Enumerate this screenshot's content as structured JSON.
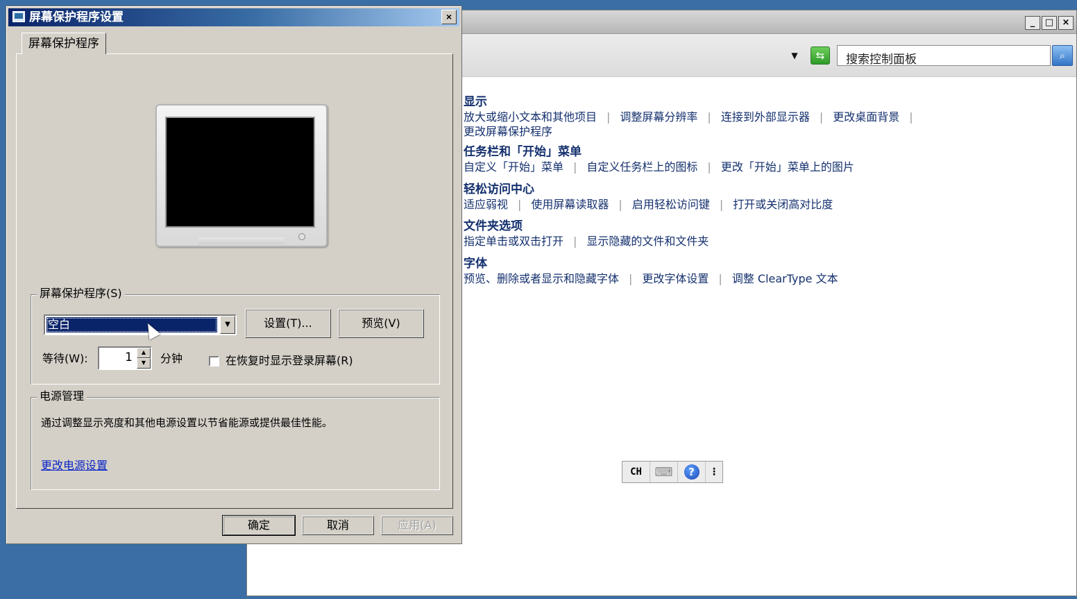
{
  "control_panel": {
    "window_buttons": [
      "_",
      "□",
      "×"
    ],
    "search_placeholder": "搜索控制面板",
    "categories": [
      {
        "icon": "display-icon",
        "title": "显示",
        "links_row1": [
          "放大或缩小文本和其他项目",
          "调整屏幕分辨率",
          "连接到外部显示器",
          "更改桌面背景"
        ],
        "links_row2": [
          "更改屏幕保护程序"
        ]
      },
      {
        "icon": "taskbar-icon",
        "title": "任务栏和「开始」菜单",
        "links_row1": [
          "自定义「开始」菜单",
          "自定义任务栏上的图标",
          "更改「开始」菜单上的图片"
        ]
      },
      {
        "icon": "ease-of-access-icon",
        "title": "轻松访问中心",
        "links_row1": [
          "适应弱视",
          "使用屏幕读取器",
          "启用轻松访问键",
          "打开或关闭高对比度"
        ]
      },
      {
        "icon": "folder-options-icon",
        "title": "文件夹选项",
        "links_row1": [
          "指定单击或双击打开",
          "显示隐藏的文件和文件夹"
        ]
      },
      {
        "icon": "fonts-icon",
        "title": "字体",
        "links_row1": [
          "预览、删除或者显示和隐藏字体",
          "更改字体设置",
          "调整 ClearType 文本"
        ]
      }
    ],
    "language_bar": {
      "lang": "CH",
      "help": "?",
      "more": "⋮"
    }
  },
  "dialog": {
    "title": "屏幕保护程序设置",
    "close": "×",
    "tab": "屏幕保护程序",
    "screensaver_group": {
      "legend": "屏幕保护程序(S)",
      "selected": "空白",
      "settings_button": "设置(T)...",
      "preview_button": "预览(V)",
      "wait_label": "等待(W):",
      "wait_value": "1",
      "minutes_label": "分钟",
      "resume_checkbox_label": "在恢复时显示登录屏幕(R)",
      "resume_checked": false
    },
    "power_group": {
      "legend": "电源管理",
      "description": "通过调整显示亮度和其他电源设置以节省能源或提供最佳性能。",
      "link": "更改电源设置"
    },
    "ok_button": "确定",
    "cancel_button": "取消",
    "apply_button": "应用(A)"
  }
}
